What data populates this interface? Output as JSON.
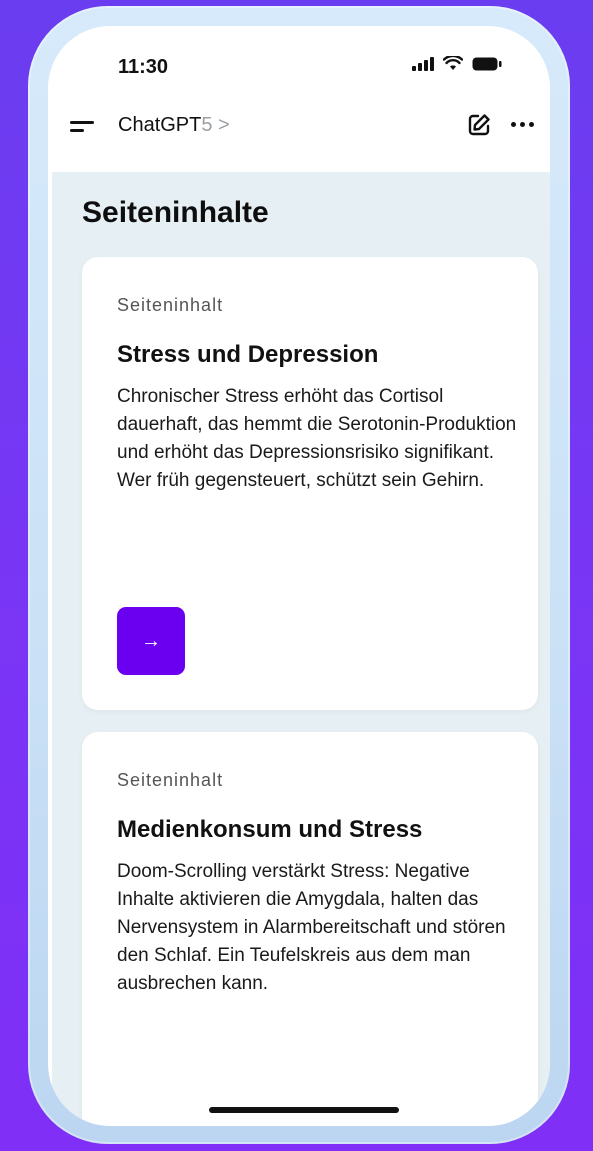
{
  "status_bar": {
    "time": "11:30",
    "icons": [
      "signal-icon",
      "wifi-icon",
      "battery-icon"
    ]
  },
  "header": {
    "menu_icon": "menu-icon",
    "app_name": "ChatGPT",
    "version": "5 >",
    "edit_icon": "edit-icon",
    "more_icon": "more-icon"
  },
  "page": {
    "heading": "Seiteninhalte"
  },
  "cards": [
    {
      "eyebrow": "Seiteninhalt",
      "title": "Stress und Depression",
      "body": "Chronischer Stress erhöht das Cortisol dauerhaft, das hemmt die Serotonin-Produktion und erhöht das Depressionsrisiko signifikant. Wer früh gegensteuert, schützt sein Gehirn.",
      "button_label": "→"
    },
    {
      "eyebrow": "Seiteninhalt",
      "title": "Medienkonsum und Stress",
      "body": "Doom-Scrolling verstärkt Stress: Negative Inhalte aktivieren die Amygdala, halten das Nervensystem in Alarmbereitschaft und stören den Schlaf. Ein Teufelskreis aus dem man ausbrechen kann."
    }
  ],
  "colors": {
    "background": "#7a35f5",
    "frame": "#c9e0f6",
    "content_bg": "#e6eff3",
    "accent_button": "#6b00f0"
  }
}
